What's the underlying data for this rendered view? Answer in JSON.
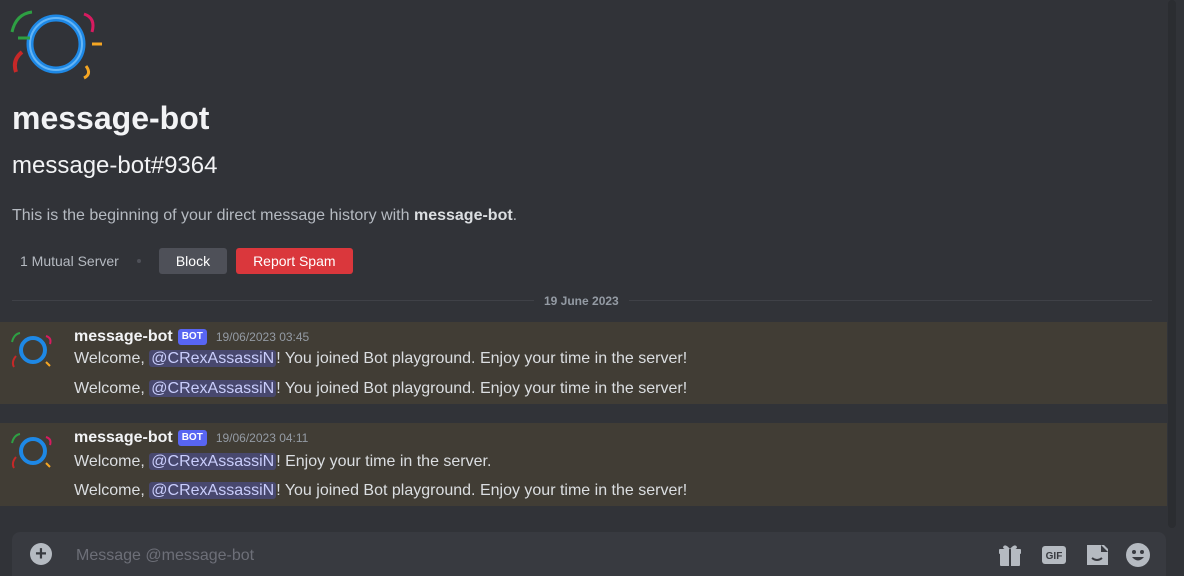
{
  "profile": {
    "name": "message-bot",
    "tag": "message-bot#9364",
    "intro_prefix": "This is the beginning of your direct message history with ",
    "intro_name": "message-bot",
    "intro_suffix": ".",
    "mutual_servers": "1 Mutual Server",
    "block_label": "Block",
    "report_label": "Report Spam"
  },
  "date_divider": "19 June 2023",
  "messages": [
    {
      "author": "message-bot",
      "badge": "BOT",
      "timestamp": "19/06/2023 03:45",
      "lines": [
        {
          "prefix": "Welcome, ",
          "mention": "@CRexAssassiN",
          "suffix": "! You joined Bot playground. Enjoy your time in the server!"
        },
        {
          "prefix": "Welcome, ",
          "mention": "@CRexAssassiN",
          "suffix": "! You joined Bot playground. Enjoy your time in the server!"
        }
      ]
    },
    {
      "author": "message-bot",
      "badge": "BOT",
      "timestamp": "19/06/2023 04:11",
      "lines": [
        {
          "prefix": "Welcome, ",
          "mention": "@CRexAssassiN",
          "suffix": "! Enjoy your time in the server."
        },
        {
          "prefix": "Welcome, ",
          "mention": "@CRexAssassiN",
          "suffix": "! You joined Bot playground. Enjoy your time in the server!"
        }
      ]
    }
  ],
  "composer": {
    "placeholder": "Message @message-bot",
    "icons": [
      "plus-circle-icon",
      "gift-icon",
      "gif-icon",
      "sticker-icon",
      "emoji-icon"
    ]
  },
  "colors": {
    "background": "#313338",
    "highlight": "#413d35",
    "mention_bg": "#3c4270",
    "bot_badge": "#5865f2",
    "report": "#da373c"
  }
}
